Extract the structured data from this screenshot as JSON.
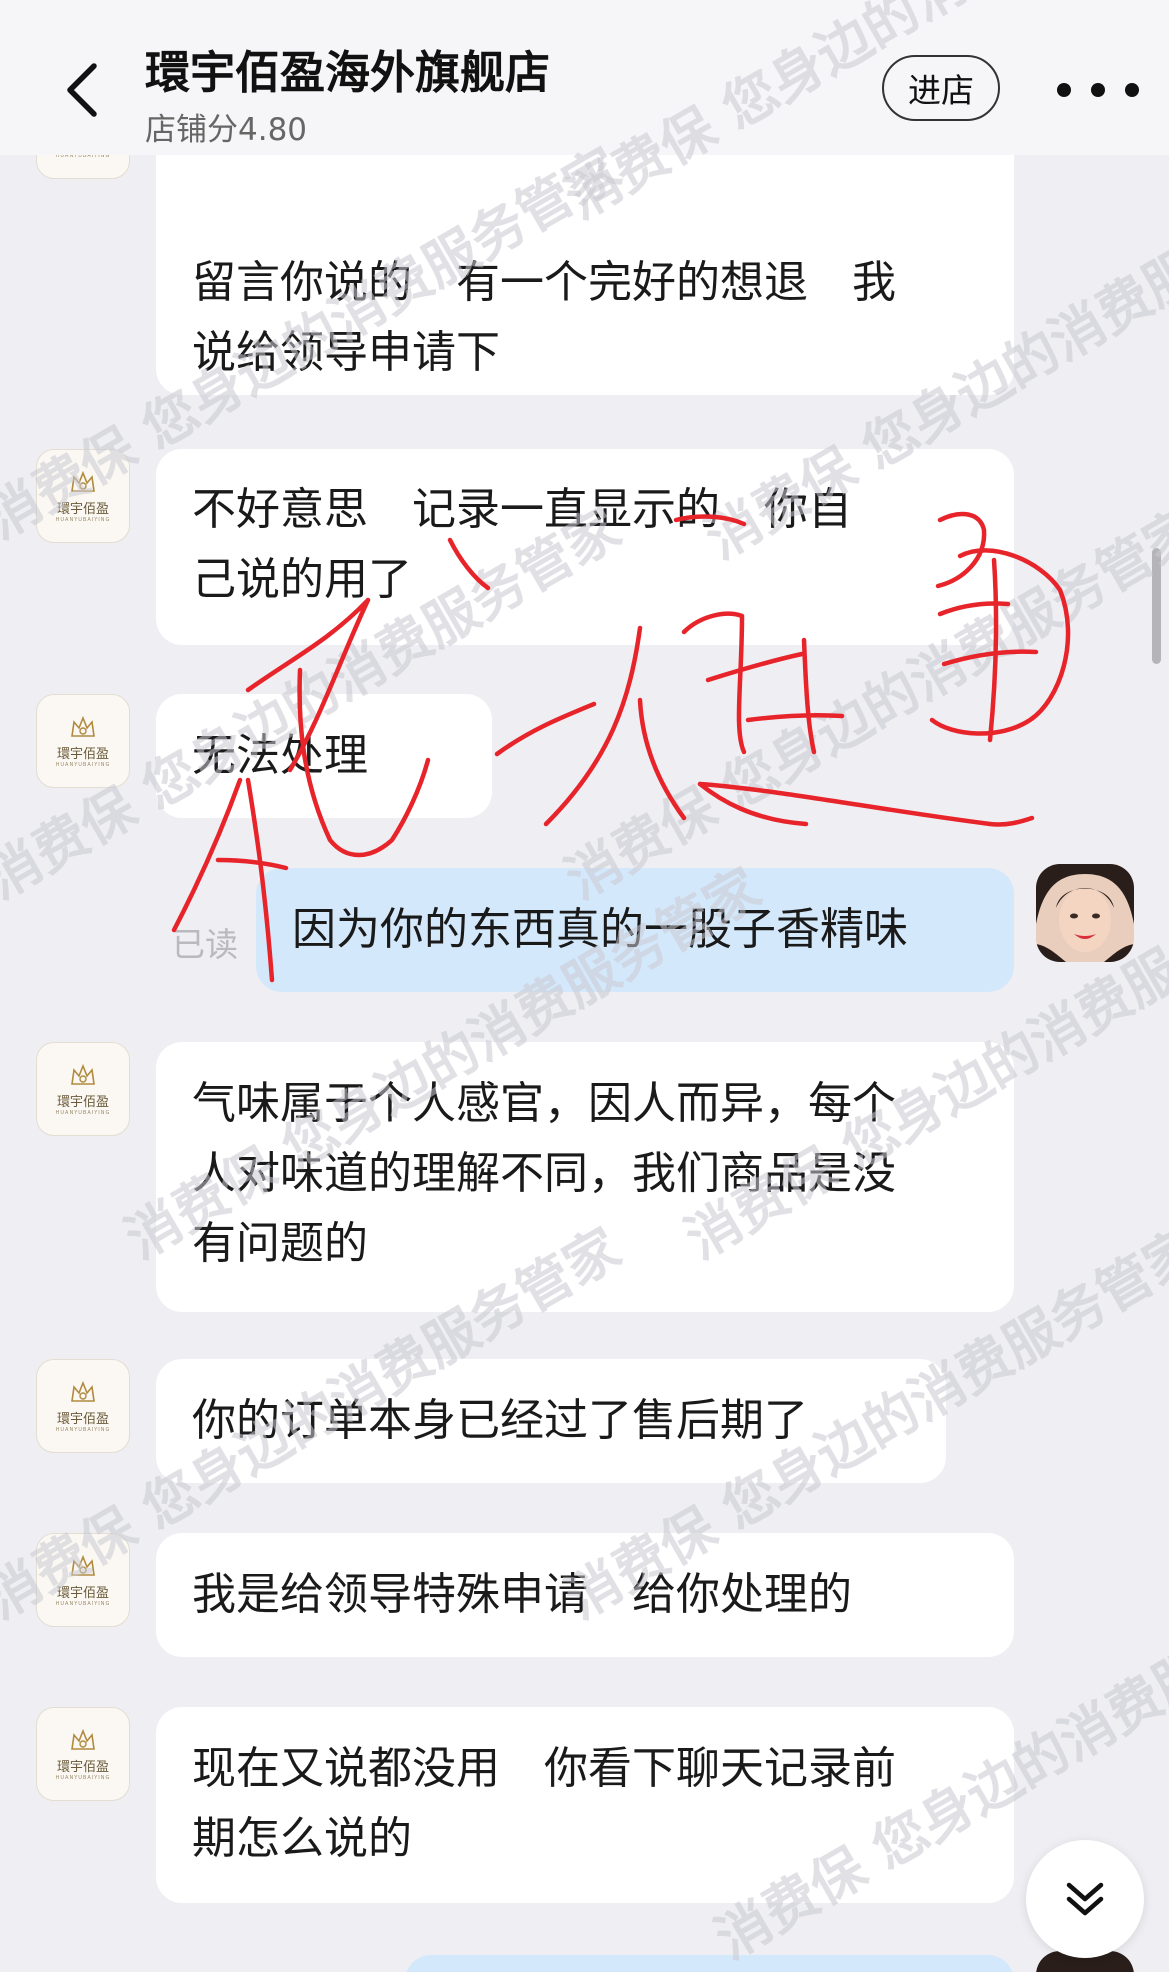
{
  "header": {
    "back_icon": "chevron-left-icon",
    "store_name": "環宇佰盈海外旗舰店",
    "store_score": "店铺分4.80",
    "enter_label": "进店",
    "more_icon": "more-horizontal-icon",
    "more_glyph": "•••"
  },
  "store_avatar": {
    "brand": "環宇佰盈",
    "brand_sub": "HUANYUBAIYING"
  },
  "messages": [
    {
      "sender": "store",
      "lines": [
        "留言你说的　有一个完好的想退　我",
        "说给领导申请下"
      ]
    },
    {
      "sender": "store",
      "lines": [
        "不好意思　记录一直显示的　你自",
        "己说的用了"
      ]
    },
    {
      "sender": "store",
      "lines": [
        "无法处理"
      ]
    },
    {
      "sender": "user",
      "lines": [
        "因为你的东西真的一股子香精味"
      ],
      "status": "已读"
    },
    {
      "sender": "store",
      "lines": [
        "气味属于个人感官，因人而异，每个",
        "人对味道的理解不同，我们商品是没",
        "有问题的"
      ]
    },
    {
      "sender": "store",
      "lines": [
        "你的订单本身已经过了售后期了"
      ]
    },
    {
      "sender": "store",
      "lines": [
        "我是给领导特殊申请　给你处理的"
      ]
    },
    {
      "sender": "store",
      "lines": [
        "现在又说都没用　你看下聊天记录前",
        "期怎么说的"
      ]
    }
  ],
  "scroll_bottom_icon": "chevrons-down-icon",
  "watermark": {
    "text": "消费保 您身边的消费服务管家",
    "color": "#c9c9cf"
  },
  "colors": {
    "background": "#eeeef3",
    "bubble_store": "#ffffff",
    "bubble_user": "#d4e8fb",
    "ink": "#e8242b"
  }
}
